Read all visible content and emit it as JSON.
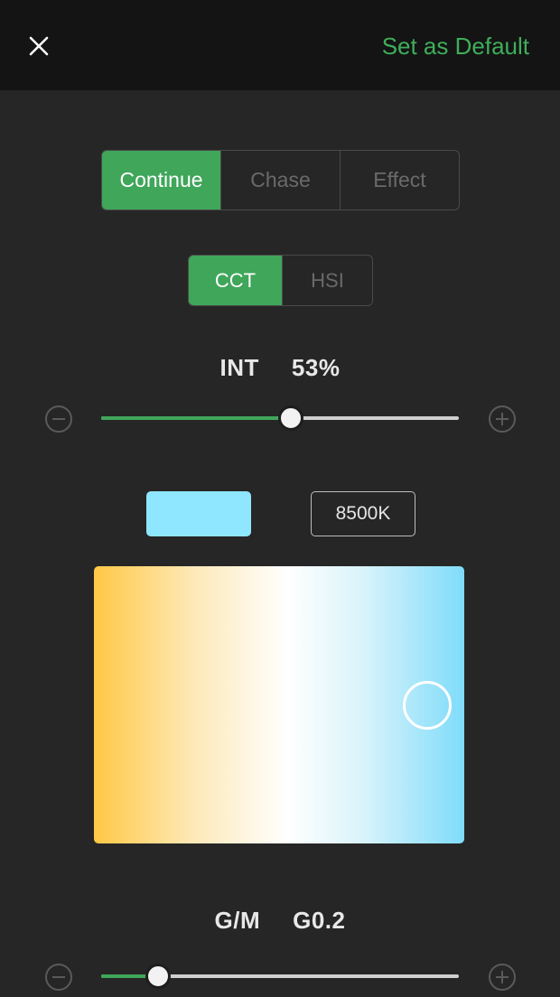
{
  "header": {
    "close_icon": "close-icon",
    "default_label": "Set as Default"
  },
  "mode_tabs": [
    {
      "label": "Continue",
      "active": true
    },
    {
      "label": "Chase",
      "active": false
    },
    {
      "label": "Effect",
      "active": false
    }
  ],
  "color_space_tabs": [
    {
      "label": "CCT",
      "active": true
    },
    {
      "label": "HSI",
      "active": false
    }
  ],
  "intensity": {
    "label": "INT",
    "value_text": "53%",
    "fraction": 0.53
  },
  "cct": {
    "swatch_color": "#8fe6ff",
    "value_text": "8500K"
  },
  "picker": {
    "handle_x": 0.9,
    "handle_y": 0.5
  },
  "gm": {
    "label": "G/M",
    "value_text": "G0.2",
    "fraction": 0.16
  },
  "colors": {
    "accent": "#3fa65a",
    "background": "#262626",
    "topbar": "#141414"
  },
  "icons": {
    "minus": "minus-circle-icon",
    "plus": "plus-circle-icon"
  }
}
